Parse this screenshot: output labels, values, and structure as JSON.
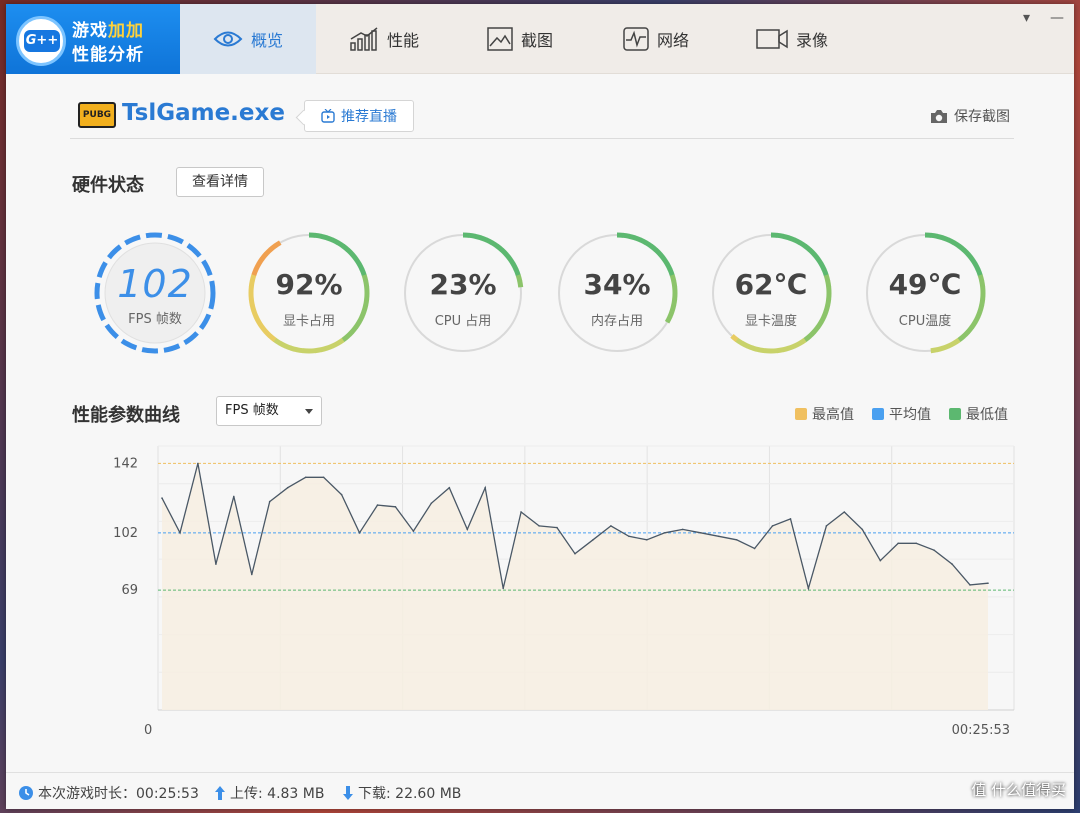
{
  "app": {
    "logo_line1_a": "游戏",
    "logo_line1_b": "加加",
    "logo_line2": "性能分析",
    "logo_badge": "G++"
  },
  "tabs": [
    {
      "label": "概览",
      "icon": "eye-icon",
      "active": true
    },
    {
      "label": "性能",
      "icon": "bar-chart-icon",
      "active": false
    },
    {
      "label": "截图",
      "icon": "image-icon",
      "active": false
    },
    {
      "label": "网络",
      "icon": "pulse-icon",
      "active": false
    },
    {
      "label": "录像",
      "icon": "video-icon",
      "active": false
    }
  ],
  "window_controls": {
    "menu": "▾",
    "minimize": "—"
  },
  "header": {
    "game_logo": "PUBG",
    "game_name": "TslGame.exe",
    "stream_button": "推荐直播",
    "save_screenshot": "保存截图"
  },
  "hardware": {
    "title": "硬件状态",
    "detail_button": "查看详情",
    "fps": {
      "value": "102",
      "label": "FPS 帧数"
    },
    "gauges": [
      {
        "value": "92%",
        "label": "显卡占用",
        "level": 0.92
      },
      {
        "value": "23%",
        "label": "CPU 占用",
        "level": 0.23
      },
      {
        "value": "34%",
        "label": "内存占用",
        "level": 0.34
      },
      {
        "value": "62℃",
        "label": "显卡温度",
        "level": 0.62
      },
      {
        "value": "49℃",
        "label": "CPU温度",
        "level": 0.49
      }
    ]
  },
  "curve": {
    "title": "性能参数曲线",
    "dropdown_value": "FPS 帧数",
    "legend": [
      {
        "label": "最高值",
        "color": "#f0c060"
      },
      {
        "label": "平均值",
        "color": "#4aa0f0"
      },
      {
        "label": "最低值",
        "color": "#5cb870"
      }
    ]
  },
  "chart_data": {
    "type": "area",
    "y_ticks": [
      "142",
      "102",
      "69"
    ],
    "x_start_label": "0",
    "x_end_label": "00:25:53",
    "max": 142,
    "avg": 102,
    "min": 69,
    "ylim": [
      0,
      152
    ],
    "values": [
      122,
      102,
      142,
      84,
      123,
      78,
      120,
      128,
      134,
      134,
      124,
      102,
      118,
      117,
      103,
      119,
      128,
      104,
      128,
      70,
      114,
      106,
      105,
      90,
      98,
      106,
      100,
      98,
      102,
      104,
      102,
      100,
      98,
      93,
      106,
      110,
      70,
      106,
      114,
      104,
      86,
      96,
      96,
      92,
      84,
      72,
      73
    ]
  },
  "status": {
    "duration": "本次游戏时长：00:25:53",
    "upload": "上传: 4.83 MB",
    "download": "下载: 22.60 MB",
    "watermark": "值 什么值得买"
  }
}
